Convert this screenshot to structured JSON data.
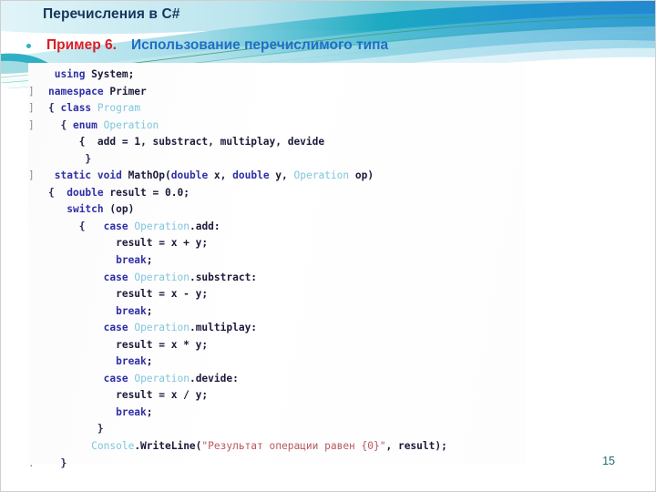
{
  "slide": {
    "title": "Перечисления в  C#",
    "page_number": "15",
    "bullet": {
      "marker": "bullet-dot",
      "label_red": "Пример 6.",
      "label_blue": "Использование перечислимого типа"
    },
    "colors": {
      "title": "#17365d",
      "accent_red": "#d81d26",
      "accent_blue": "#1f6fc4",
      "bullet": "#31afc4",
      "page_number": "#1f6e6e",
      "band_teal": "#16a6bd",
      "band_blue": "#1f8fd0",
      "band_light": "#a9dde8",
      "band_pale": "#d8f0f5",
      "code_keyword": "#2f2fa8",
      "code_type": "#7fc6da",
      "code_string": "#b8585f",
      "code_plain": "#1b1b3a",
      "code_gutter": "#8d8d8d"
    }
  },
  "code": {
    "language": "csharp",
    "lines": [
      {
        "gutter": "",
        "indent": 1,
        "tokens": [
          {
            "t": "using",
            "c": "kw"
          },
          {
            "t": " System;",
            "c": "pln"
          }
        ]
      },
      {
        "gutter": "]",
        "indent": 0,
        "tokens": [
          {
            "t": "namespace",
            "c": "kw"
          },
          {
            "t": " Primer",
            "c": "pln"
          }
        ]
      },
      {
        "gutter": "]",
        "indent": 0,
        "tokens": [
          {
            "t": "{ ",
            "c": "brc"
          },
          {
            "t": "class",
            "c": "kw"
          },
          {
            "t": " ",
            "c": "pln"
          },
          {
            "t": "Program",
            "c": "typ"
          }
        ]
      },
      {
        "gutter": "]",
        "indent": 2,
        "tokens": [
          {
            "t": "{ ",
            "c": "brc"
          },
          {
            "t": "enum",
            "c": "kw"
          },
          {
            "t": " ",
            "c": "pln"
          },
          {
            "t": "Operation",
            "c": "typ"
          }
        ]
      },
      {
        "gutter": "",
        "indent": 5,
        "tokens": [
          {
            "t": "{  add = ",
            "c": "pln"
          },
          {
            "t": "1",
            "c": "num"
          },
          {
            "t": ", substract, multiplay, devide",
            "c": "pln"
          }
        ]
      },
      {
        "gutter": "",
        "indent": 6,
        "tokens": [
          {
            "t": "}",
            "c": "brc"
          }
        ]
      },
      {
        "gutter": "]",
        "indent": 1,
        "tokens": [
          {
            "t": "static",
            "c": "kw"
          },
          {
            "t": " ",
            "c": "pln"
          },
          {
            "t": "void",
            "c": "kw"
          },
          {
            "t": " MathOp(",
            "c": "pln"
          },
          {
            "t": "double",
            "c": "kw"
          },
          {
            "t": " x, ",
            "c": "pln"
          },
          {
            "t": "double",
            "c": "kw"
          },
          {
            "t": " y, ",
            "c": "pln"
          },
          {
            "t": "Operation",
            "c": "typ"
          },
          {
            "t": " op)",
            "c": "pln"
          }
        ]
      },
      {
        "gutter": "",
        "indent": 0,
        "tokens": [
          {
            "t": "{  ",
            "c": "brc"
          },
          {
            "t": "double",
            "c": "kw"
          },
          {
            "t": " result = ",
            "c": "pln"
          },
          {
            "t": "0.0",
            "c": "num"
          },
          {
            "t": ";",
            "c": "pln"
          }
        ]
      },
      {
        "gutter": "",
        "indent": 3,
        "tokens": [
          {
            "t": "switch",
            "c": "kw"
          },
          {
            "t": " (op)",
            "c": "pln"
          }
        ]
      },
      {
        "gutter": "",
        "indent": 5,
        "tokens": [
          {
            "t": "{   ",
            "c": "brc"
          },
          {
            "t": "case",
            "c": "kw"
          },
          {
            "t": " ",
            "c": "pln"
          },
          {
            "t": "Operation",
            "c": "typ"
          },
          {
            "t": ".add:",
            "c": "pln"
          }
        ]
      },
      {
        "gutter": "",
        "indent": 11,
        "tokens": [
          {
            "t": "result = x + y;",
            "c": "pln"
          }
        ]
      },
      {
        "gutter": "",
        "indent": 11,
        "tokens": [
          {
            "t": "break",
            "c": "kw"
          },
          {
            "t": ";",
            "c": "pln"
          }
        ]
      },
      {
        "gutter": "",
        "indent": 9,
        "tokens": [
          {
            "t": "case",
            "c": "kw"
          },
          {
            "t": " ",
            "c": "pln"
          },
          {
            "t": "Operation",
            "c": "typ"
          },
          {
            "t": ".substract:",
            "c": "pln"
          }
        ]
      },
      {
        "gutter": "",
        "indent": 11,
        "tokens": [
          {
            "t": "result = x - y;",
            "c": "pln"
          }
        ]
      },
      {
        "gutter": "",
        "indent": 11,
        "tokens": [
          {
            "t": "break",
            "c": "kw"
          },
          {
            "t": ";",
            "c": "pln"
          }
        ]
      },
      {
        "gutter": "",
        "indent": 9,
        "tokens": [
          {
            "t": "case",
            "c": "kw"
          },
          {
            "t": " ",
            "c": "pln"
          },
          {
            "t": "Operation",
            "c": "typ"
          },
          {
            "t": ".multiplay:",
            "c": "pln"
          }
        ]
      },
      {
        "gutter": "",
        "indent": 11,
        "tokens": [
          {
            "t": "result = x * y;",
            "c": "pln"
          }
        ]
      },
      {
        "gutter": "",
        "indent": 11,
        "tokens": [
          {
            "t": "break",
            "c": "kw"
          },
          {
            "t": ";",
            "c": "pln"
          }
        ]
      },
      {
        "gutter": "",
        "indent": 9,
        "tokens": [
          {
            "t": "case",
            "c": "kw"
          },
          {
            "t": " ",
            "c": "pln"
          },
          {
            "t": "Operation",
            "c": "typ"
          },
          {
            "t": ".devide:",
            "c": "pln"
          }
        ]
      },
      {
        "gutter": "",
        "indent": 11,
        "tokens": [
          {
            "t": "result = x / y;",
            "c": "pln"
          }
        ]
      },
      {
        "gutter": "",
        "indent": 11,
        "tokens": [
          {
            "t": "break",
            "c": "kw"
          },
          {
            "t": ";",
            "c": "pln"
          }
        ]
      },
      {
        "gutter": "",
        "indent": 8,
        "tokens": [
          {
            "t": "}",
            "c": "brc"
          }
        ]
      },
      {
        "gutter": "",
        "indent": 7,
        "tokens": [
          {
            "t": "Console",
            "c": "typ"
          },
          {
            "t": ".WriteLine(",
            "c": "pln"
          },
          {
            "t": "\"Результат операции равен {0}\"",
            "c": "str"
          },
          {
            "t": ", result);",
            "c": "pln"
          }
        ]
      },
      {
        "gutter": ".",
        "indent": 2,
        "tokens": [
          {
            "t": "}",
            "c": "brc"
          }
        ]
      }
    ]
  }
}
